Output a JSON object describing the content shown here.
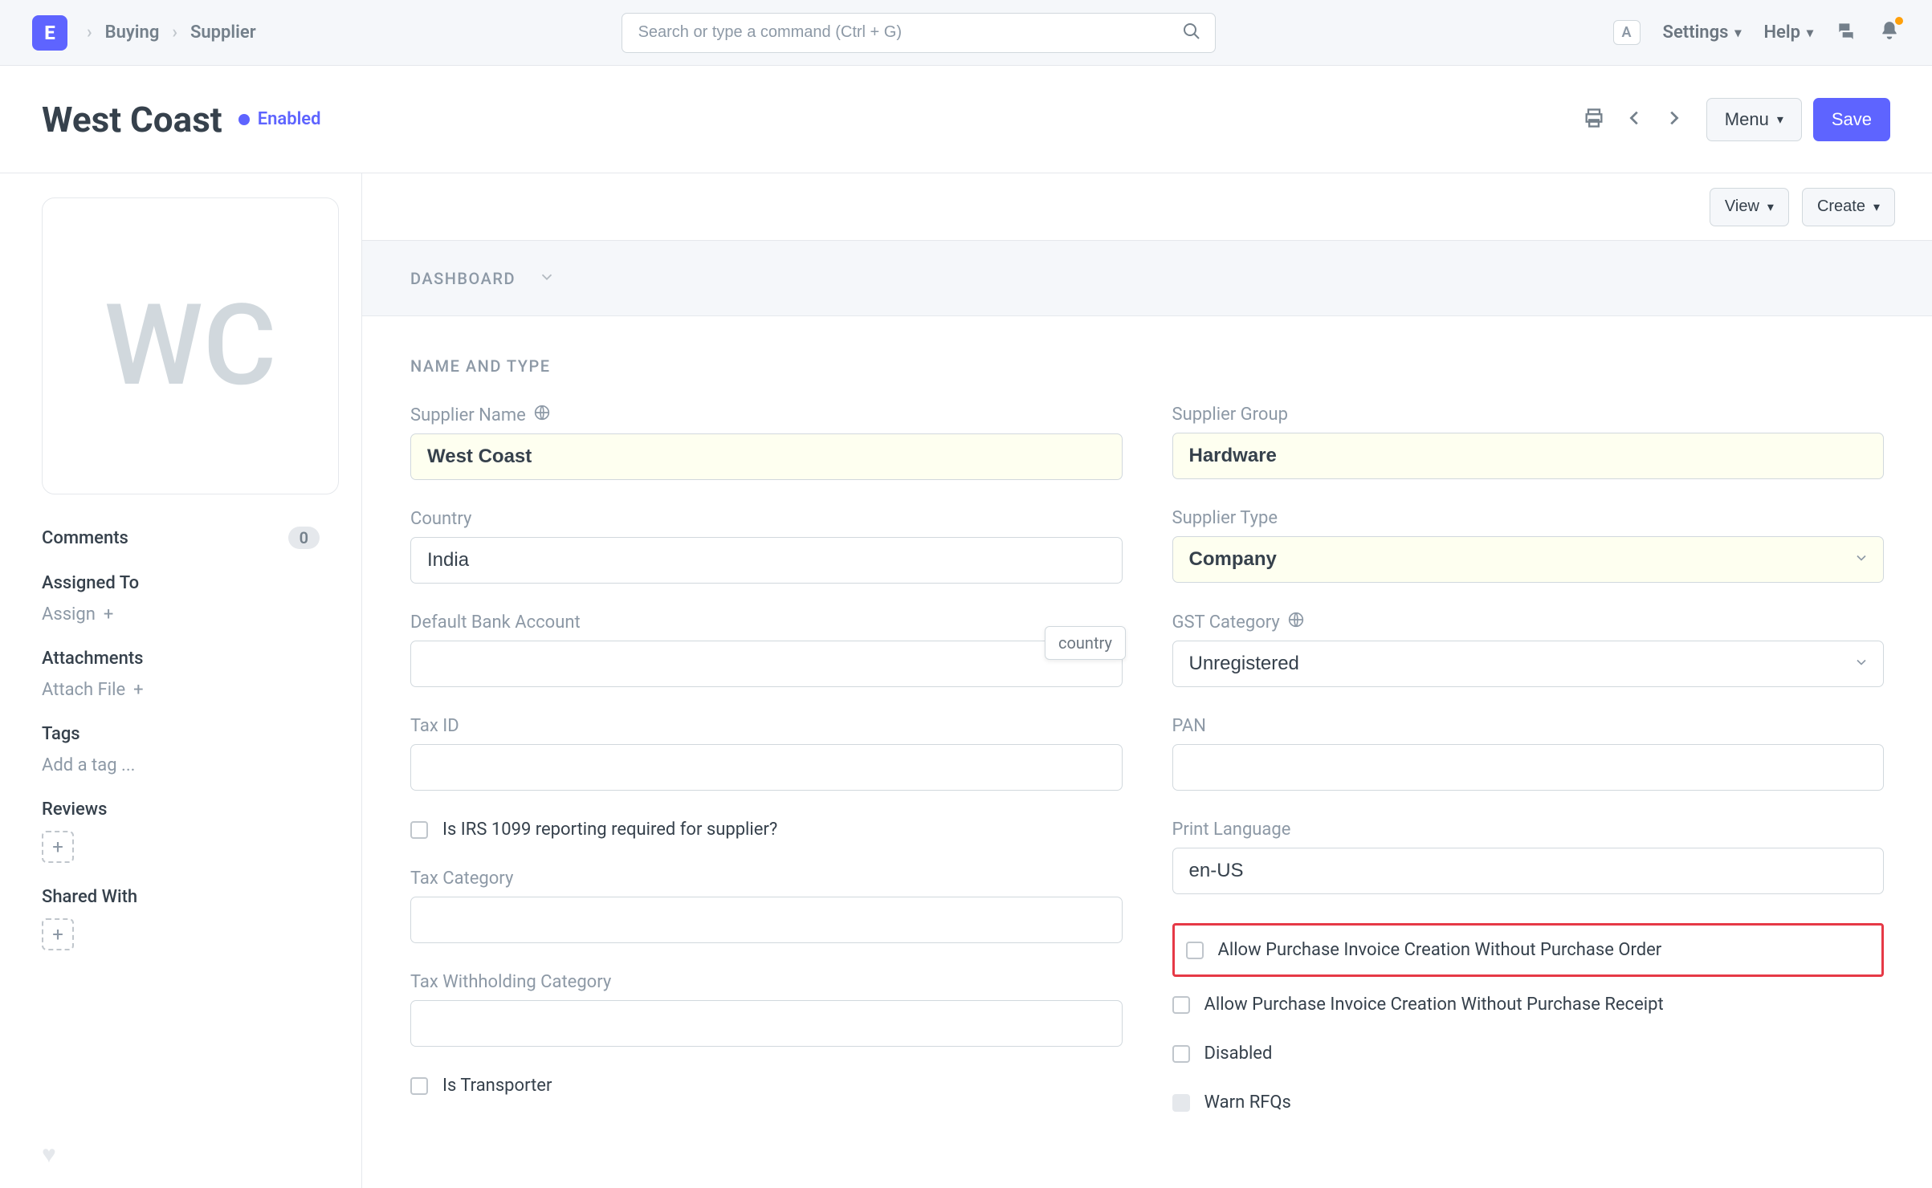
{
  "navbar": {
    "logo_letter": "E",
    "breadcrumb": [
      "Buying",
      "Supplier"
    ],
    "search_placeholder": "Search or type a command (Ctrl + G)",
    "kbd": "A",
    "settings_label": "Settings",
    "help_label": "Help"
  },
  "page": {
    "title": "West Coast",
    "status": "Enabled",
    "menu_label": "Menu",
    "save_label": "Save"
  },
  "content_actions": {
    "view_label": "View",
    "create_label": "Create"
  },
  "dashboard_bar": "DASHBOARD",
  "sidebar": {
    "avatar_initials": "WC",
    "comments_label": "Comments",
    "comments_count": "0",
    "assigned_label": "Assigned To",
    "assign_action": "Assign",
    "attachments_label": "Attachments",
    "attach_action": "Attach File",
    "tags_label": "Tags",
    "add_tag": "Add a tag ...",
    "reviews_label": "Reviews",
    "shared_label": "Shared With"
  },
  "form": {
    "section_heading": "NAME AND TYPE",
    "supplier_name_label": "Supplier Name",
    "supplier_name_value": "West Coast",
    "country_label": "Country",
    "country_value": "India",
    "default_bank_label": "Default Bank Account",
    "default_bank_value": "",
    "tax_id_label": "Tax ID",
    "tax_id_value": "",
    "irs_label": "Is IRS 1099 reporting required for supplier?",
    "tax_category_label": "Tax Category",
    "tax_category_value": "",
    "tax_withholding_label": "Tax Withholding Category",
    "tax_withholding_value": "",
    "is_transporter_label": "Is Transporter",
    "supplier_group_label": "Supplier Group",
    "supplier_group_value": "Hardware",
    "supplier_type_label": "Supplier Type",
    "supplier_type_value": "Company",
    "gst_category_label": "GST Category",
    "gst_category_value": "Unregistered",
    "pan_label": "PAN",
    "pan_value": "",
    "print_language_label": "Print Language",
    "print_language_value": "en-US",
    "allow_po_label": "Allow Purchase Invoice Creation Without Purchase Order",
    "allow_pr_label": "Allow Purchase Invoice Creation Without Purchase Receipt",
    "disabled_label": "Disabled",
    "warn_rfq_label": "Warn RFQs",
    "tooltip_country": "country"
  }
}
